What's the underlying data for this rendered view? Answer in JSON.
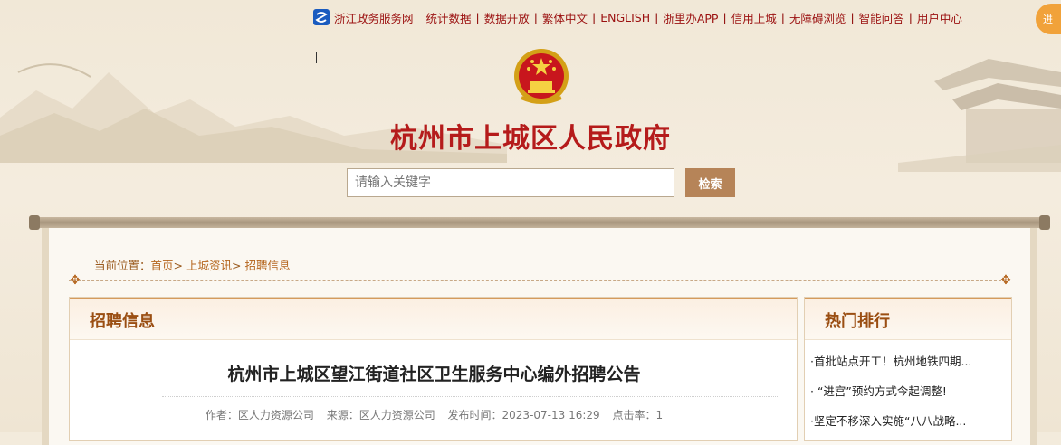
{
  "topnav": {
    "items": [
      "浙江政务服务网",
      "统计数据",
      "数据开放",
      "繁体中文",
      "ENGLISH",
      "浙里办APP",
      "信用上城",
      "无障碍浏览",
      "智能问答",
      "用户中心"
    ],
    "badge": "进"
  },
  "site_title": "杭州市上城区人民政府",
  "search": {
    "placeholder": "请输入关键字",
    "button": "检索"
  },
  "breadcrumb": {
    "prefix": "当前位置：",
    "home": "首页",
    "section": "上城资讯",
    "current": "招聘信息",
    "sep": ">"
  },
  "main": {
    "heading": "招聘信息",
    "article_title": "杭州市上城区望江街道社区卫生服务中心编外招聘公告",
    "meta": {
      "author": "作者：区人力资源公司",
      "source": "来源：区人力资源公司",
      "published": "发布时间：2023-07-13 16:29",
      "clicks": "点击率：1"
    }
  },
  "side": {
    "heading": "热门排行",
    "items": [
      "·首批站点开工！杭州地铁四期...",
      "· “进宫”预约方式今起调整!",
      "·坚定不移深入实施“八八战略..."
    ]
  },
  "colors": {
    "brand_red": "#b51b1b",
    "accent_brown": "#b68458",
    "heading_brown": "#9a4e12"
  }
}
